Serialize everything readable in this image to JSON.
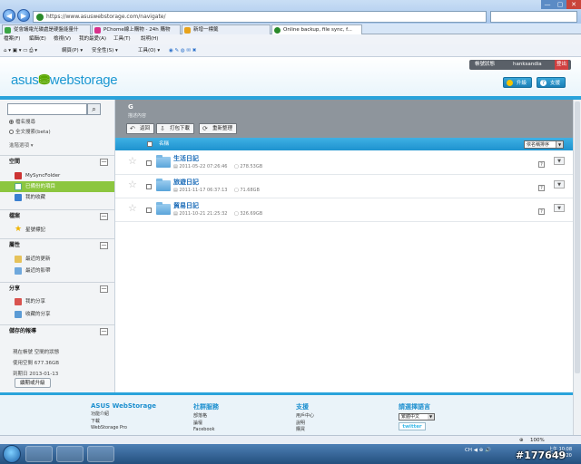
{
  "browser": {
    "url": "https://www.asuswebstorage.com/navigate/",
    "tabs": [
      {
        "label": "從會議電光碟處是硬盤能量什"
      },
      {
        "label": "PChome線上購物 - 24h 購物"
      },
      {
        "label": "新增一標籤"
      },
      {
        "label": "Online backup, file sync, f..."
      }
    ],
    "menu": [
      "檔案(F)",
      "編輯(E)",
      "檢視(V)",
      "我的最愛(A)",
      "工具(T)",
      "說明(H)"
    ],
    "cmd": [
      "網頁(P) ▾",
      "安全性(S) ▾",
      "工具(O) ▾"
    ],
    "zoom": "100%",
    "win_controls": [
      "—",
      "▢",
      "✕"
    ]
  },
  "site": {
    "logo_a": "asus",
    "logo_b": "webstorage",
    "userbar": {
      "account": "帳號狀態",
      "username": "hanksandia",
      "logout": "登出"
    },
    "upgrade": "升級",
    "help": "支援"
  },
  "sidebar": {
    "search_placeholder": "",
    "search_options": [
      "檔名搜尋",
      "全文搜索(beta)"
    ],
    "advanced": "進階選項 ▾",
    "sections": {
      "space": "空間",
      "files": "檔案",
      "attributes": "屬性",
      "share": "分享",
      "storage": "儲存的報導"
    },
    "space_items": [
      "MySyncFolder",
      "已備份的項目",
      "我的收藏"
    ],
    "files_items": [
      "星號標記"
    ],
    "attr_items": [
      "最近的更新",
      "最近的影帶"
    ],
    "share_items": [
      "我的分享",
      "收藏的分享"
    ],
    "quota": {
      "plan": "現在帳號 空間的狀態",
      "used": "使用空間 677.36GB",
      "expiry": "到期日 2013-01-13",
      "upgrade_btn": "續期或升級"
    }
  },
  "main": {
    "folder_title": "G",
    "folder_sub": "描述內容",
    "toolbar": {
      "back": "返回",
      "download": "打包下載",
      "refresh": "重新整理"
    },
    "columns": {
      "name": "名稱"
    },
    "sort": "依名稱排序",
    "rows": [
      {
        "name": "生活日記",
        "date": "2011-05-22 07:26:46",
        "size": "278.53GB"
      },
      {
        "name": "旅遊日記",
        "date": "2011-11-17 06:37:13",
        "size": "71.68GB"
      },
      {
        "name": "貿易日記",
        "date": "2011-10-21 21:25:32",
        "size": "326.69GB"
      }
    ]
  },
  "footer": {
    "col1": {
      "title": "ASUS WebStorage",
      "links": [
        "功能介紹",
        "下載",
        "WebStorage Pro"
      ]
    },
    "col2": {
      "title": "社群服務",
      "links": [
        "部落格",
        "論壇",
        "Facebook"
      ]
    },
    "col3": {
      "title": "支援",
      "links": [
        "用戶中心",
        "說明",
        "購買"
      ]
    },
    "col4": {
      "title": "請選擇語言",
      "lang": "繁體中文",
      "twitter": "twitter"
    }
  },
  "taskbar": {
    "tray": "CH ◀ ⊕ 🔊",
    "time": "上午 10:08",
    "date": "2011/7/20"
  },
  "watermark": "#177649"
}
